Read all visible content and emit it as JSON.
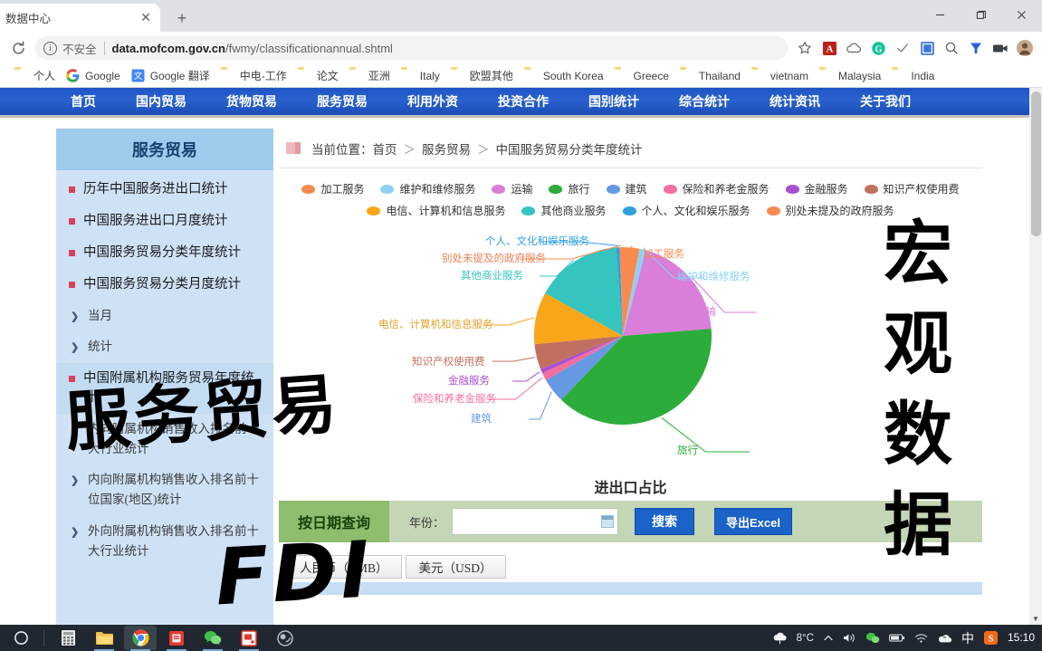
{
  "browser": {
    "tab_title": "数据中心",
    "close_label": "✕",
    "new_tab_label": "+",
    "security_label": "不安全",
    "url_bold": "data.mofcom.gov.cn",
    "url_rest": "/fwmy/classificationannual.shtml",
    "reload_icon": "reload-icon",
    "window_minimize": "minimize-icon",
    "window_maximize": "maximize-icon",
    "window_close": "close-icon",
    "extensions": [
      "bookmark-star-icon",
      "adobe-acrobat-icon",
      "cloud-icon",
      "grammarly-icon",
      "checkmark-icon",
      "translate-icon",
      "magnifier-icon",
      "yandex-icon",
      "camera-icon",
      "profile-avatar-icon"
    ],
    "bookmarks": [
      {
        "label": "个人"
      },
      {
        "label": "Google"
      },
      {
        "label": "Google 翻译"
      },
      {
        "label": "中电-工作"
      },
      {
        "label": "论文"
      },
      {
        "label": "亚洲"
      },
      {
        "label": "Italy"
      },
      {
        "label": "欧盟其他"
      },
      {
        "label": "South Korea"
      },
      {
        "label": "Greece"
      },
      {
        "label": "Thailand"
      },
      {
        "label": "vietnam"
      },
      {
        "label": "Malaysia"
      },
      {
        "label": "India"
      }
    ]
  },
  "site_nav": [
    {
      "label": "首页"
    },
    {
      "label": "国内贸易"
    },
    {
      "label": "货物贸易"
    },
    {
      "label": "服务贸易"
    },
    {
      "label": "利用外资"
    },
    {
      "label": "投资合作"
    },
    {
      "label": "国别统计"
    },
    {
      "label": "综合统计"
    },
    {
      "label": "统计资讯"
    },
    {
      "label": "关于我们"
    }
  ],
  "sidebar": {
    "title": "服务贸易",
    "items": [
      {
        "label": "历年中国服务进出口统计",
        "type": "bullet"
      },
      {
        "label": "中国服务进出口月度统计",
        "type": "bullet"
      },
      {
        "label": "中国服务贸易分类年度统计",
        "type": "bullet"
      },
      {
        "label": "中国服务贸易分类月度统计",
        "type": "bullet"
      },
      {
        "label": "当月",
        "type": "arrow"
      },
      {
        "label": "统计",
        "type": "arrow"
      },
      {
        "label": "中国附属机构服务贸易年度统计",
        "type": "bullet"
      },
      {
        "label": "内向附属机构销售收入排名前十大行业统计",
        "type": "arrow"
      },
      {
        "label": "内向附属机构销售收入排名前十位国家(地区)统计",
        "type": "arrow"
      },
      {
        "label": "外向附属机构销售收入排名前十大行业统计",
        "type": "arrow"
      }
    ]
  },
  "breadcrumb": {
    "prefix": "当前位置：",
    "items": [
      "首页",
      "服务贸易",
      "中国服务贸易分类年度统计"
    ],
    "separator": "＞"
  },
  "chart_data": {
    "type": "pie",
    "title": "进出口占比",
    "legend_position": "top",
    "categories": [
      "加工服务",
      "维护和维修服务",
      "运输",
      "旅行",
      "建筑",
      "保险和养老金服务",
      "金融服务",
      "知识产权使用费",
      "电信、计算机和信息服务",
      "其他商业服务",
      "个人、文化和娱乐服务",
      "别处未提及的政府服务"
    ],
    "colors": [
      "#f98a4f",
      "#8fd2f0",
      "#d97ed9",
      "#2cac3a",
      "#6699e3",
      "#f26fa0",
      "#a94fd1",
      "#c1705f",
      "#f9a61a",
      "#35c4c0",
      "#2f9fe0",
      "#f98a4f"
    ],
    "values": [
      3.0,
      1.2,
      19.5,
      38.5,
      4.5,
      1.4,
      0.8,
      4.6,
      9.5,
      15.8,
      0.6,
      0.6
    ],
    "ylabel": "",
    "xlabel": ""
  },
  "filter": {
    "header": "按日期查询",
    "year_label": "年份：",
    "year_value": "",
    "year_placeholder": "",
    "calendar_icon": "calendar-icon",
    "search_button": "搜索",
    "export_button": "导出Excel"
  },
  "currency_tabs": [
    {
      "label": "人民币（RMB）",
      "selected": true
    },
    {
      "label": "美元（USD）",
      "selected": false
    }
  ],
  "watermarks": {
    "left_top": "服务贸易",
    "left_bottom": "FDI",
    "right": [
      "宏",
      "观",
      "数",
      "据"
    ]
  },
  "taskbar": {
    "start_icon": "start-circle-icon",
    "apps": [
      {
        "name": "calculator-icon"
      },
      {
        "name": "file-explorer-icon"
      },
      {
        "name": "chrome-icon"
      },
      {
        "name": "pdf-reader-icon"
      },
      {
        "name": "wechat-icon"
      },
      {
        "name": "note-app-icon"
      },
      {
        "name": "obs-icon"
      }
    ],
    "weather_temp": "8°C",
    "tray": [
      "chevron-up-icon",
      "volume-icon",
      "wechat-tray-icon",
      "battery-icon",
      "wifi-icon",
      "onedrive-icon",
      "ime-chinese-icon",
      "sogou-icon"
    ],
    "ime_label": "中",
    "clock": "15:10"
  }
}
